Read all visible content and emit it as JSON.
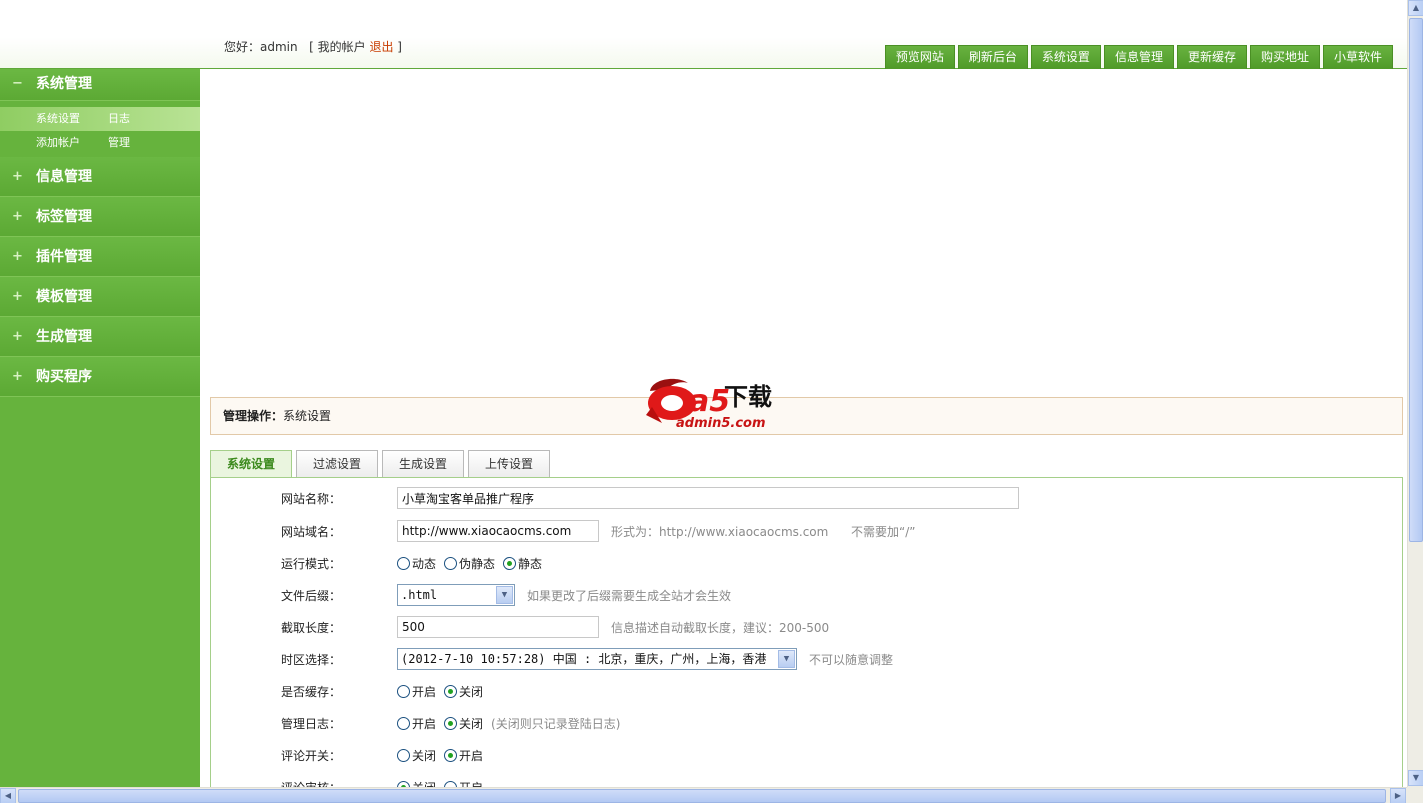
{
  "header": {
    "greeting_prefix": "您好：",
    "username": "admin",
    "bracket_open": "[",
    "my_account": "我的帐户",
    "logout": "退出",
    "bracket_close": "]"
  },
  "topnav": [
    "预览网站",
    "刷新后台",
    "系统设置",
    "信息管理",
    "更新缓存",
    "购买地址",
    "小草软件"
  ],
  "sidebar": {
    "system": {
      "label": "系统管理",
      "marker": "−",
      "sub": [
        {
          "a": "系统设置",
          "b": "日志"
        },
        {
          "a": "添加帐户",
          "b": "管理"
        }
      ]
    },
    "menus": [
      {
        "label": "信息管理",
        "marker": "+"
      },
      {
        "label": "标签管理",
        "marker": "+"
      },
      {
        "label": "插件管理",
        "marker": "+"
      },
      {
        "label": "模板管理",
        "marker": "+"
      },
      {
        "label": "生成管理",
        "marker": "+"
      },
      {
        "label": "购买程序",
        "marker": "+"
      }
    ]
  },
  "logo": {
    "brand": "a5",
    "brand_cn": "下载",
    "domain": "admin5.com"
  },
  "operation": {
    "label": "管理操作：",
    "current": "系统设置"
  },
  "tabs": [
    "系统设置",
    "过滤设置",
    "生成设置",
    "上传设置"
  ],
  "form": {
    "site_name": {
      "label": "网站名称：",
      "value": "小草淘宝客单品推广程序"
    },
    "site_domain": {
      "label": "网站域名：",
      "value": "http://www.xiaocaocms.com",
      "hint1": "形式为：http://www.xiaocaocms.com",
      "hint2": "不需要加“/”"
    },
    "run_mode": {
      "label": "运行模式：",
      "options": [
        "动态",
        "伪静态",
        "静态"
      ]
    },
    "suffix": {
      "label": "文件后缀：",
      "value": ".html",
      "hint": "如果更改了后缀需要生成全站才会生效"
    },
    "cut_length": {
      "label": "截取长度：",
      "value": "500",
      "hint": "信息描述自动截取长度，建议：200-500"
    },
    "timezone": {
      "label": "时区选择：",
      "value": "(2012-7-10 10:57:28) 中国 : 北京，重庆，广州，上海，香港",
      "hint": "不可以随意调整"
    },
    "cache": {
      "label": "是否缓存：",
      "options": [
        "开启",
        "关闭"
      ]
    },
    "admin_log": {
      "label": "管理日志：",
      "options": [
        "开启",
        "关闭"
      ],
      "note": "(关闭则只记录登陆日志)"
    },
    "comment": {
      "label": "评论开关：",
      "options": [
        "关闭",
        "开启"
      ]
    },
    "comment_review": {
      "label": "评论审核：",
      "options": [
        "关闭",
        "开启"
      ]
    }
  },
  "icons": {
    "arrow_up": "▲",
    "arrow_down": "▼",
    "arrow_left": "◀",
    "arrow_right": "▶"
  }
}
